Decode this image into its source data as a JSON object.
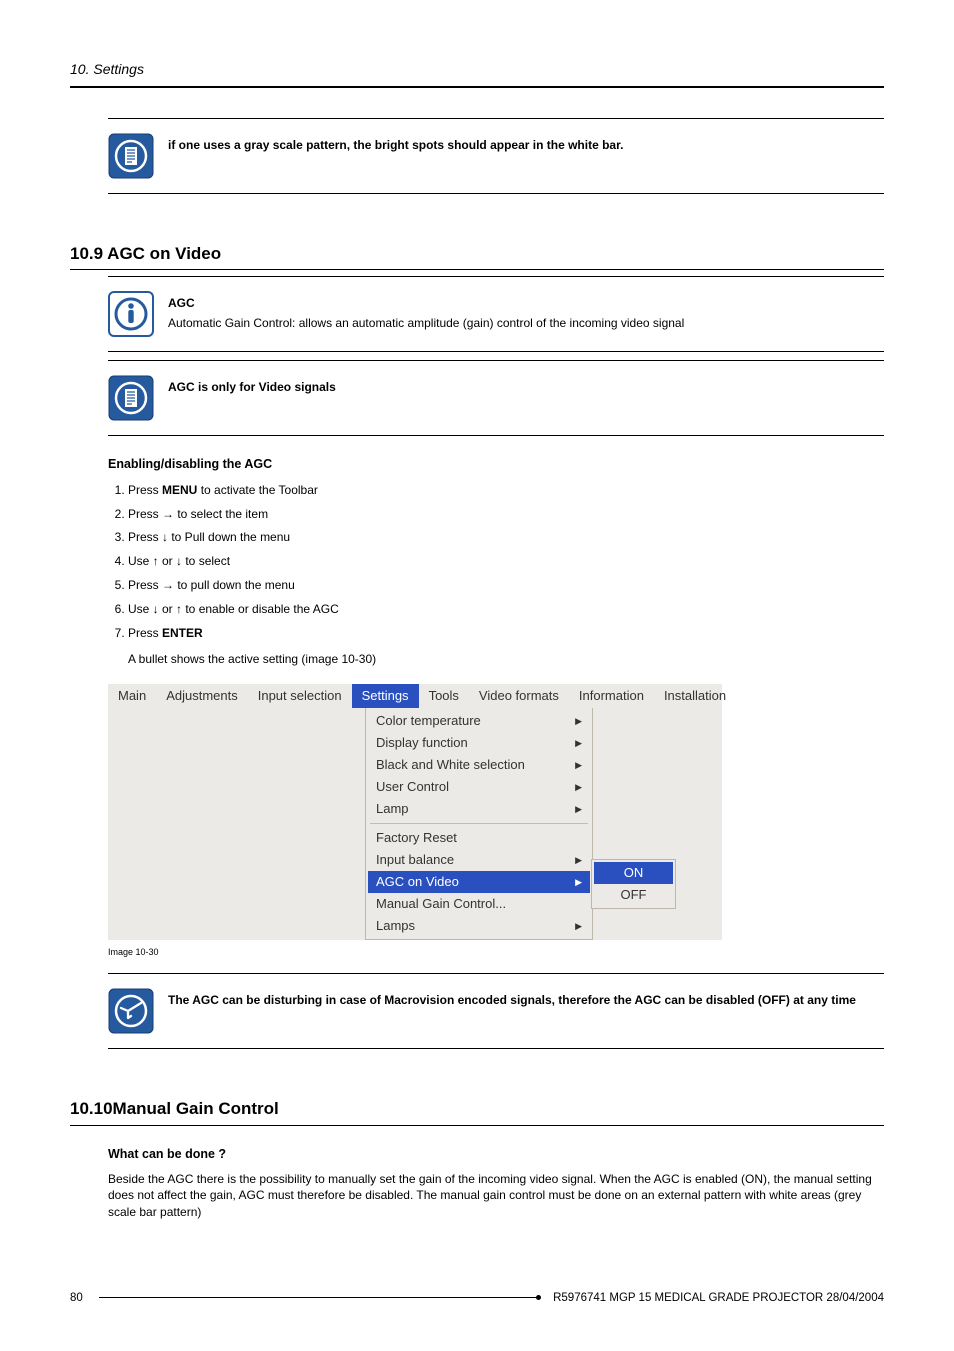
{
  "header": {
    "section_title": "10.  Settings"
  },
  "note1": {
    "text": "if one uses a gray scale pattern, the bright spots should appear in the white bar."
  },
  "sec109": {
    "heading": "10.9 AGC on Video",
    "def": {
      "title": "AGC",
      "body": "Automatic Gain Control: allows an automatic amplitude (gain) control of the incoming video signal"
    },
    "note": {
      "text": "AGC is only for Video signals"
    },
    "sub1": "Enabling/disabling the AGC",
    "steps": [
      {
        "pre": "Press ",
        "bold": "MENU",
        "post": " to activate the Toolbar"
      },
      {
        "pre": "Press → to select the ",
        "italic": "",
        "post": " item"
      },
      {
        "pre": "Press ↓ to Pull down the menu",
        "bold": "",
        "post": ""
      },
      {
        "pre": "Use ↑ or ↓ to select ",
        "italic": "",
        "post": ""
      },
      {
        "pre": "Press → to pull down the menu",
        "bold": "",
        "post": ""
      },
      {
        "pre": "Use ↓ or ↑ to enable or disable the AGC",
        "bold": "",
        "post": ""
      },
      {
        "pre": "Press ",
        "bold": "ENTER",
        "post": ""
      }
    ],
    "result_line": "A bullet shows the active setting (image 10-30)",
    "image_caption": "Image 10-30",
    "tip": "The AGC can be disturbing in case of Macrovision encoded signals, therefore the AGC can be disabled (OFF) at any time"
  },
  "menubar": {
    "items": [
      "Main",
      "Adjustments",
      "Input selection",
      "Settings",
      "Tools",
      "Video formats",
      "Information",
      "Installation"
    ],
    "active_index": 3
  },
  "dropdown": {
    "group1": [
      {
        "label": "Color temperature",
        "arrow": true
      },
      {
        "label": "Display function",
        "arrow": true
      },
      {
        "label": "Black and White selection",
        "arrow": true
      },
      {
        "label": "User Control",
        "arrow": true
      },
      {
        "label": "Lamp",
        "arrow": true
      }
    ],
    "group2": [
      {
        "label": "Factory Reset",
        "arrow": false
      },
      {
        "label": "Input balance",
        "arrow": true
      },
      {
        "label": "AGC on Video",
        "arrow": true,
        "highlight": true
      },
      {
        "label": "Manual Gain Control...",
        "arrow": false
      },
      {
        "label": "Lamps",
        "arrow": true
      }
    ]
  },
  "submenu": {
    "items": [
      {
        "label": "ON",
        "highlight": true
      },
      {
        "label": "OFF",
        "highlight": false
      }
    ]
  },
  "sec1010": {
    "heading": "10.10Manual Gain Control",
    "sub1": "What can be done ?",
    "para": "Beside the AGC there is the possibility to manually set the gain of the incoming video signal.  When the AGC is enabled (ON), the manual setting does not affect the gain, AGC must therefore be disabled.  The manual gain control must be done on an external pattern with white areas (grey scale bar pattern)"
  },
  "footer": {
    "page": "80",
    "doc": "R5976741   MGP 15 MEDICAL GRADE PROJECTOR  28/04/2004"
  }
}
